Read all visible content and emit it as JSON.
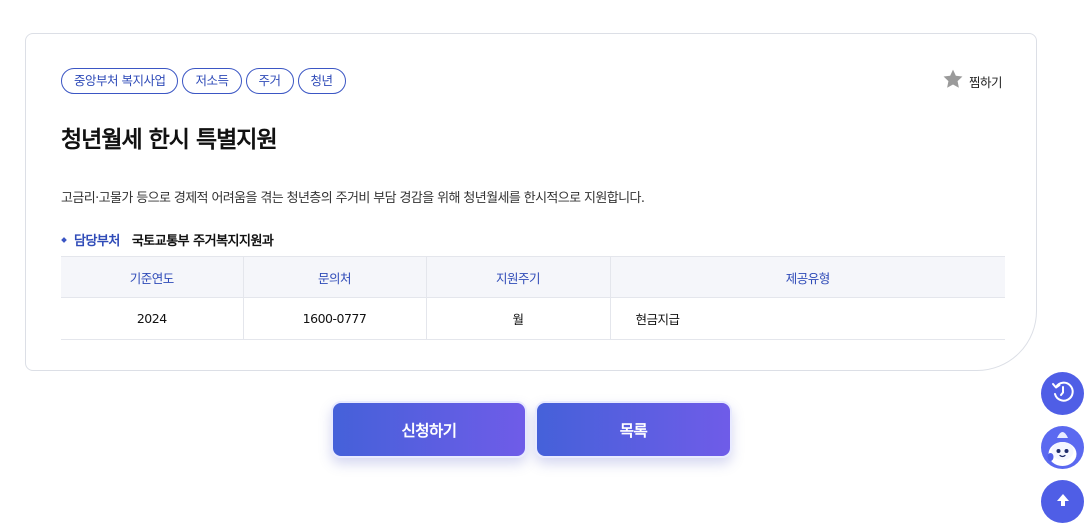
{
  "tags": [
    "중앙부처 복지사업",
    "저소득",
    "주거",
    "청년"
  ],
  "bookmark_label": "찜하기",
  "title": "청년월세 한시 특별지원",
  "description": "고금리·고물가 등으로 경제적 어려움을 겪는 청년층의 주거비 부담 경감을 위해 청년월세를 한시적으로 지원합니다.",
  "dept": {
    "label": "담당부처",
    "value": "국토교통부 주거복지지원과"
  },
  "table": {
    "headers": [
      "기준연도",
      "문의처",
      "지원주기",
      "제공유형"
    ],
    "row": [
      "2024",
      "1600-0777",
      "월",
      "현금지급"
    ]
  },
  "buttons": {
    "apply": "신청하기",
    "list": "목록"
  },
  "icons": {
    "bookmark": "star-icon",
    "history": "history-icon",
    "chat": "chatbot-icon",
    "top": "scroll-top-icon"
  },
  "colors": {
    "accent": "#2f4bb8",
    "button_start": "#4561d9",
    "button_end": "#6f5ce8",
    "fab": "#4f5ee6"
  }
}
